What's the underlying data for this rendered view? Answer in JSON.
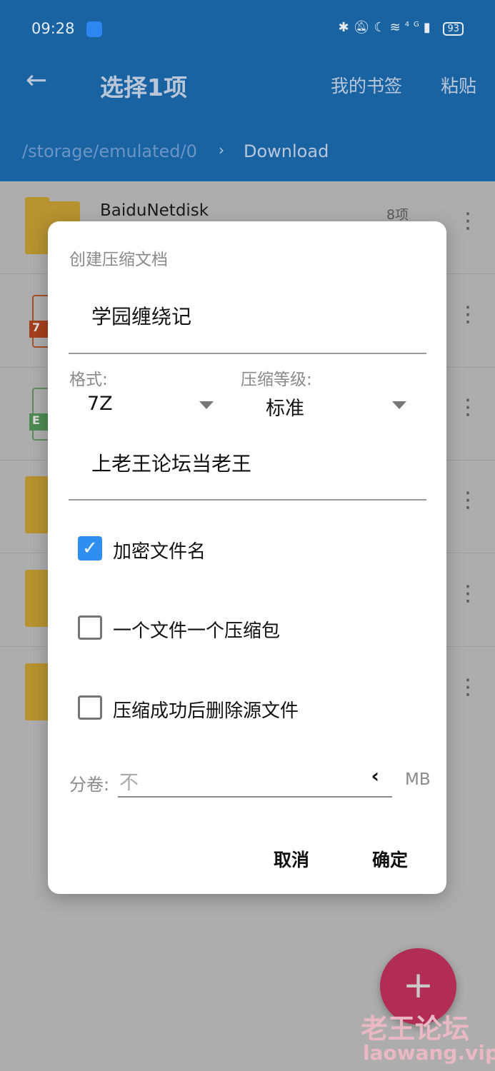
{
  "status_bar": {
    "time": "09:28",
    "icons": [
      "bluetooth-icon",
      "vibrate-icon",
      "moon-icon",
      "wifi-icon",
      "signal-4g-icon"
    ],
    "network": "4G",
    "battery": "93"
  },
  "header": {
    "title": "选择1项",
    "bookmarks": "我的书签",
    "paste": "粘贴",
    "path_root": "/storage/emulated/0",
    "path_sep": "›",
    "path_current": "Download"
  },
  "files": [
    {
      "name": "BaiduNetdisk",
      "count": "8项",
      "type": "folder"
    },
    {
      "type": "archive",
      "badge": "7"
    },
    {
      "type": "excel",
      "badge": "E"
    },
    {
      "type": "folder"
    },
    {
      "type": "folder"
    },
    {
      "type": "folder"
    }
  ],
  "dialog": {
    "title": "创建压缩文档",
    "filename": "学园缠绕记",
    "format_label": "格式:",
    "format_value": "7Z",
    "level_label": "压缩等级:",
    "level_value": "标准",
    "password": "上老王论坛当老王",
    "options": [
      {
        "label": "加密文件名",
        "checked": true
      },
      {
        "label": "一个文件一个压缩包",
        "checked": false
      },
      {
        "label": "压缩成功后删除源文件",
        "checked": false
      }
    ],
    "split_label": "分卷:",
    "split_placeholder": "不",
    "split_arrow": "‹",
    "split_unit": "MB",
    "cancel": "取消",
    "ok": "确定"
  },
  "fab": "+",
  "watermark": {
    "cn": "老王论坛",
    "url": "laowang.vip"
  },
  "colors": {
    "header": "#1a63a3",
    "fab": "#b22c58",
    "checkbox": "#2e8ff0"
  }
}
